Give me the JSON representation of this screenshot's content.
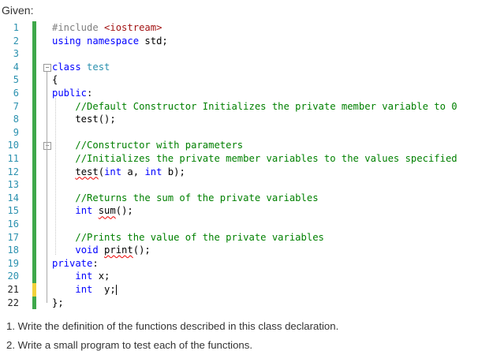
{
  "intro": "Given:",
  "code": {
    "lines": [
      {
        "n": "1",
        "parts": [
          {
            "c": "pre",
            "t": "#include "
          },
          {
            "c": "str",
            "t": "<iostream>"
          }
        ]
      },
      {
        "n": "2",
        "parts": [
          {
            "c": "kw",
            "t": "using namespace "
          },
          {
            "c": "plain",
            "t": "std;"
          }
        ]
      },
      {
        "n": "3",
        "parts": []
      },
      {
        "n": "4",
        "parts": [
          {
            "c": "kw",
            "t": "class "
          },
          {
            "c": "cls",
            "t": "test"
          }
        ]
      },
      {
        "n": "5",
        "parts": [
          {
            "c": "plain",
            "t": "{"
          }
        ]
      },
      {
        "n": "6",
        "parts": [
          {
            "c": "kw",
            "t": "public"
          },
          {
            "c": "plain",
            "t": ":"
          }
        ]
      },
      {
        "n": "7",
        "parts": [
          {
            "c": "plain",
            "t": "    "
          },
          {
            "c": "cmt",
            "t": "//Default Constructor Initializes the private member variable to 0"
          }
        ]
      },
      {
        "n": "8",
        "parts": [
          {
            "c": "plain",
            "t": "    test();"
          }
        ]
      },
      {
        "n": "9",
        "parts": []
      },
      {
        "n": "10",
        "parts": [
          {
            "c": "plain",
            "t": "    "
          },
          {
            "c": "cmt",
            "t": "//Constructor with parameters"
          }
        ]
      },
      {
        "n": "11",
        "parts": [
          {
            "c": "plain",
            "t": "    "
          },
          {
            "c": "cmt",
            "t": "//Initializes the private member variables to the values specified"
          }
        ]
      },
      {
        "n": "12",
        "parts": [
          {
            "c": "plain",
            "t": "    "
          },
          {
            "c": "plain squig",
            "t": "test"
          },
          {
            "c": "plain",
            "t": "("
          },
          {
            "c": "kw",
            "t": "int"
          },
          {
            "c": "plain",
            "t": " a, "
          },
          {
            "c": "kw",
            "t": "int"
          },
          {
            "c": "plain",
            "t": " b);"
          }
        ]
      },
      {
        "n": "13",
        "parts": []
      },
      {
        "n": "14",
        "parts": [
          {
            "c": "plain",
            "t": "    "
          },
          {
            "c": "cmt",
            "t": "//Returns the sum of the private variables"
          }
        ]
      },
      {
        "n": "15",
        "parts": [
          {
            "c": "plain",
            "t": "    "
          },
          {
            "c": "kw",
            "t": "int "
          },
          {
            "c": "plain squig",
            "t": "sum"
          },
          {
            "c": "plain",
            "t": "();"
          }
        ]
      },
      {
        "n": "16",
        "parts": []
      },
      {
        "n": "17",
        "parts": [
          {
            "c": "plain",
            "t": "    "
          },
          {
            "c": "cmt",
            "t": "//Prints the value of the private variables"
          }
        ]
      },
      {
        "n": "18",
        "parts": [
          {
            "c": "plain",
            "t": "    "
          },
          {
            "c": "kw",
            "t": "void "
          },
          {
            "c": "plain squig",
            "t": "print"
          },
          {
            "c": "plain",
            "t": "();"
          }
        ]
      },
      {
        "n": "19",
        "parts": [
          {
            "c": "kw",
            "t": "private"
          },
          {
            "c": "plain",
            "t": ":"
          }
        ]
      },
      {
        "n": "20",
        "parts": [
          {
            "c": "plain",
            "t": "    "
          },
          {
            "c": "kw",
            "t": "int"
          },
          {
            "c": "plain",
            "t": " x;"
          }
        ]
      },
      {
        "n": "21",
        "parts": [
          {
            "c": "plain",
            "t": "    "
          },
          {
            "c": "kw",
            "t": "int"
          },
          {
            "c": "plain",
            "t": "  y;"
          }
        ]
      },
      {
        "n": "22",
        "parts": [
          {
            "c": "plain",
            "t": "};"
          }
        ]
      }
    ]
  },
  "questions": [
    "1. Write the definition of the functions described in this class declaration.",
    "2. Write a small program to test each of the functions."
  ],
  "colors": {
    "keyword": "#0000ff",
    "class_name": "#2b91af",
    "string": "#a31515",
    "comment": "#008000",
    "preprocessor": "#808080",
    "line_number": "#2b91af",
    "changed_saved": "#3ea84a",
    "changed_unsaved": "#f2d13a"
  }
}
